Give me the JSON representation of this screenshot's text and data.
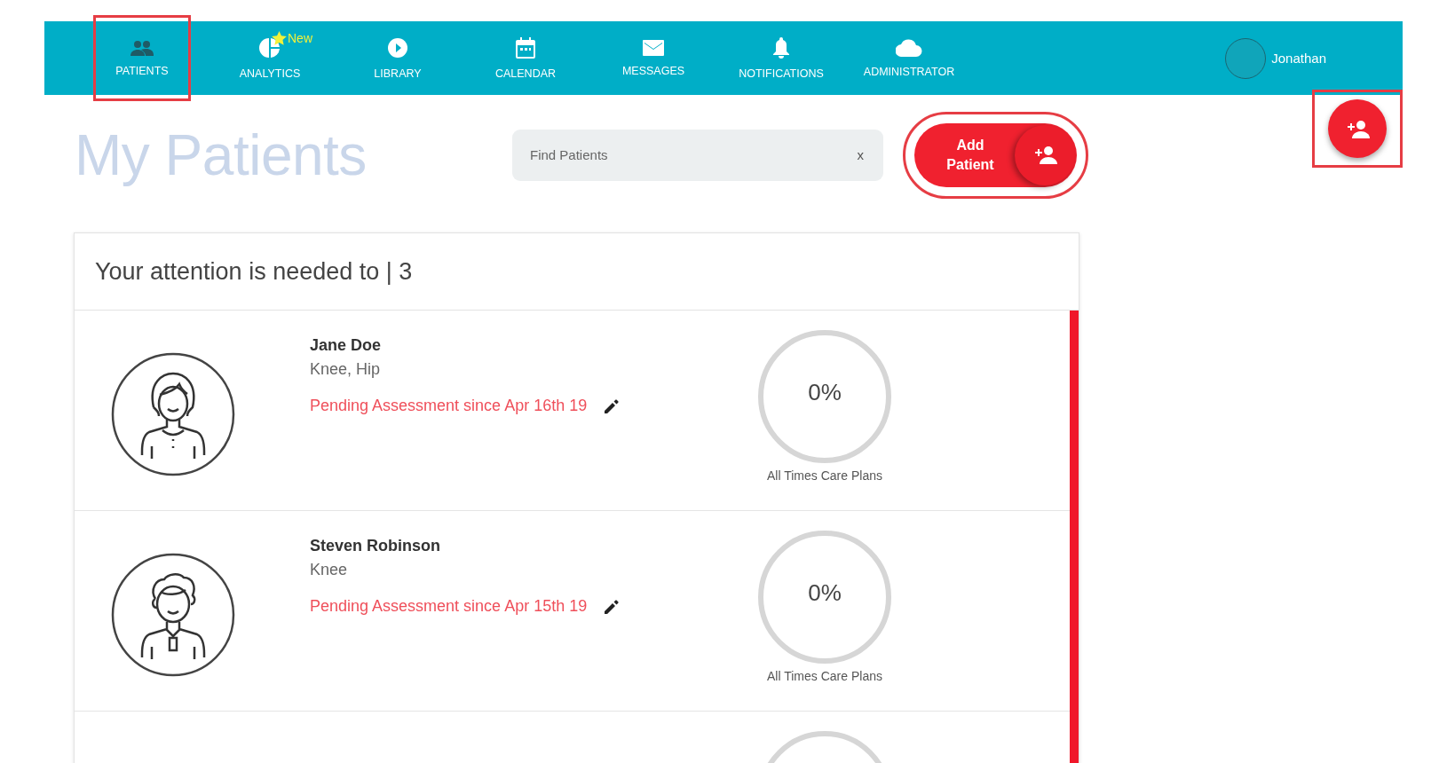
{
  "nav": {
    "tabs": [
      {
        "label": "PATIENTS",
        "selected": true
      },
      {
        "label": "ANALYTICS",
        "selected": false,
        "badge": "New"
      },
      {
        "label": "LIBRARY",
        "selected": false
      },
      {
        "label": "CALENDAR",
        "selected": false
      },
      {
        "label": "MESSAGES",
        "selected": false
      },
      {
        "label": "NOTIFICATIONS",
        "selected": false
      },
      {
        "label": "ADMINISTRATOR",
        "selected": false
      }
    ],
    "user": {
      "name": "Jonathan"
    }
  },
  "page_title": "My Patients",
  "search": {
    "placeholder": "Find Patients",
    "clear": "x"
  },
  "add_button": {
    "label": "Add Patient"
  },
  "attention": {
    "title": "Your attention is needed to | 3",
    "patients": [
      {
        "kind": "female",
        "name": "Jane Doe",
        "conditions": "Knee, Hip",
        "status": "Pending Assessment since Apr 16th 19",
        "progress": "0%",
        "level": 0,
        "caption": "All Times Care Plans"
      },
      {
        "kind": "male",
        "name": "Steven Robinson",
        "conditions": "Knee",
        "status": "Pending Assessment since Apr 15th 19",
        "progress": "0%",
        "level": 0,
        "caption": "All Times Care Plans"
      }
    ]
  }
}
